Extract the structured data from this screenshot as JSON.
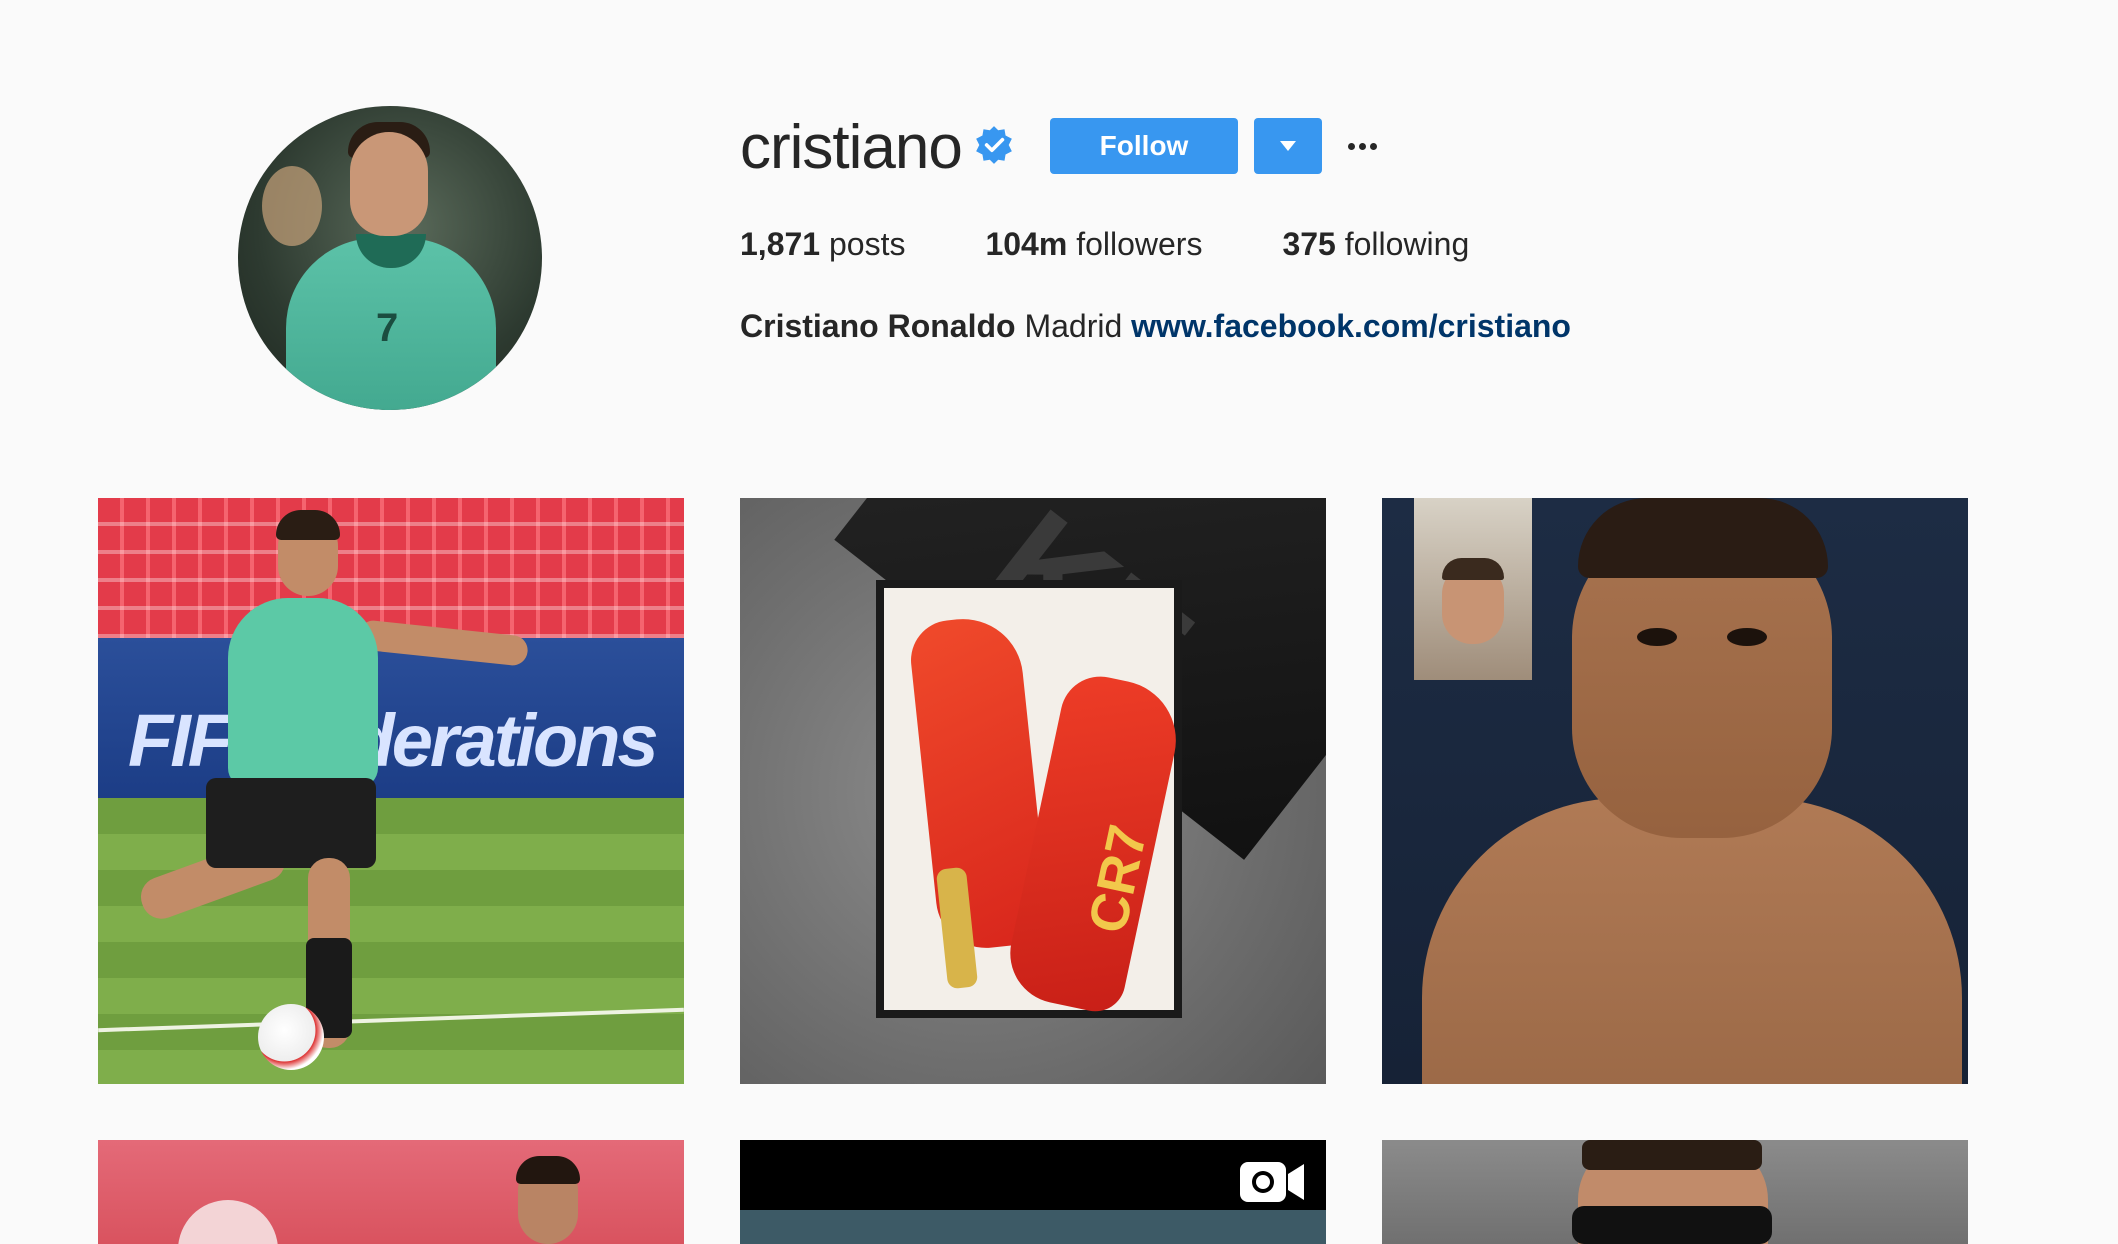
{
  "profile": {
    "username": "cristiano",
    "verified": true,
    "follow_label": "Follow",
    "full_name": "Cristiano Ronaldo",
    "bio_text": "Madrid",
    "website": "www.facebook.com/cristiano"
  },
  "stats": {
    "posts_count": "1,871",
    "posts_label": "posts",
    "followers_count": "104m",
    "followers_label": "followers",
    "following_count": "375",
    "following_label": "following"
  },
  "posts": {
    "tile1_board_text": "FIF  nfederations",
    "tile2_lid_text": "KE",
    "tile2_boot_text": "CR7",
    "tile5_type": "video"
  },
  "colors": {
    "accent": "#3897f0",
    "link": "#003569",
    "verified_badge": "#3897f0",
    "background": "#fafafa",
    "text": "#262626"
  },
  "icons": {
    "verified": "verified-badge-icon",
    "dropdown": "caret-down-icon",
    "more": "more-options-icon",
    "video": "video-camera-icon"
  }
}
